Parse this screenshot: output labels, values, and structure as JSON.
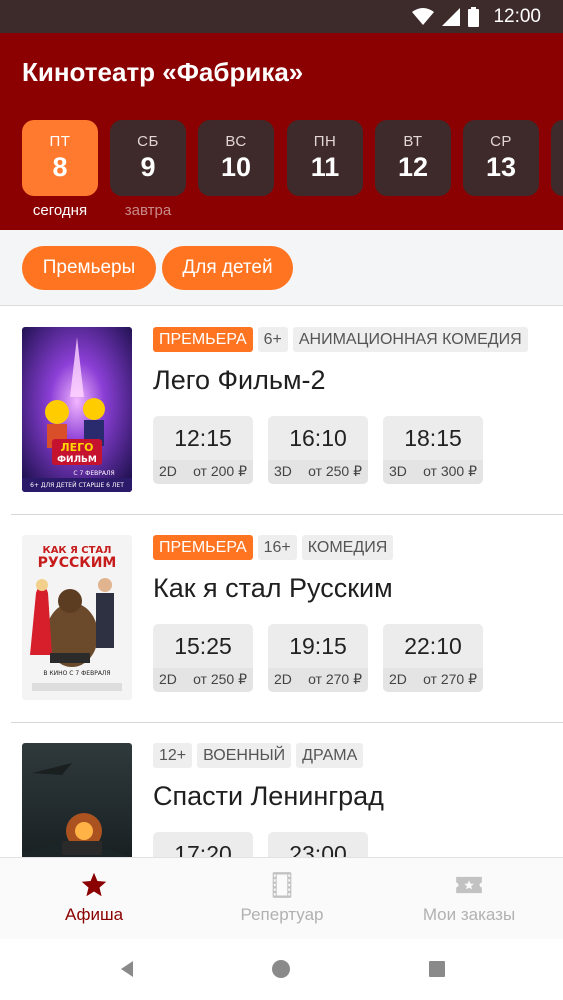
{
  "status": {
    "time": "12:00"
  },
  "app": {
    "title": "Кинотеатр «Фабрика»"
  },
  "days": [
    {
      "name": "ПТ",
      "num": "8",
      "sub": "сегодня",
      "active": true
    },
    {
      "name": "СБ",
      "num": "9",
      "sub": "завтра"
    },
    {
      "name": "ВС",
      "num": "10",
      "sub": ""
    },
    {
      "name": "ПН",
      "num": "11",
      "sub": ""
    },
    {
      "name": "ВТ",
      "num": "12",
      "sub": ""
    },
    {
      "name": "СР",
      "num": "13",
      "sub": ""
    }
  ],
  "filters": [
    "Премьеры",
    "Для детей"
  ],
  "movies": [
    {
      "tags": [
        "ПРЕМЬЕРА",
        "6+",
        "АНИМАЦИОННАЯ КОМЕДИЯ"
      ],
      "title": "Лего Фильм-2",
      "sessions": [
        {
          "time": "12:15",
          "format": "2D",
          "price": "от 200 ₽"
        },
        {
          "time": "16:10",
          "format": "3D",
          "price": "от 250 ₽"
        },
        {
          "time": "18:15",
          "format": "3D",
          "price": "от 300 ₽"
        }
      ]
    },
    {
      "tags": [
        "ПРЕМЬЕРА",
        "16+",
        "КОМЕДИЯ"
      ],
      "title": "Как я стал Русским",
      "sessions": [
        {
          "time": "15:25",
          "format": "2D",
          "price": "от 250 ₽"
        },
        {
          "time": "19:15",
          "format": "2D",
          "price": "от 270 ₽"
        },
        {
          "time": "22:10",
          "format": "2D",
          "price": "от 270 ₽"
        }
      ]
    },
    {
      "tags": [
        "12+",
        "ВОЕННЫЙ",
        "ДРАМА"
      ],
      "title": "Спасти Ленинград",
      "sessions": [
        {
          "time": "17:20",
          "format": "",
          "price": ""
        },
        {
          "time": "23:00",
          "format": "",
          "price": ""
        }
      ]
    }
  ],
  "posters": {
    "lego": {
      "caption": "6+ ДЛЯ ДЕТЕЙ СТАРШЕ 6 ЛЕТ",
      "logo_line1": "ЛЕГО",
      "logo_line2": "ФИЛЬМ",
      "date": "С 7 ФЕВРАЛЯ"
    },
    "russian": {
      "title_line1": "КАК Я СТАЛ",
      "title_line2": "РУССКИМ",
      "date": "В КИНО С 7 ФЕВРАЛЯ"
    }
  },
  "nav": [
    {
      "label": "Афиша",
      "icon": "star-icon",
      "active": true
    },
    {
      "label": "Репертуар",
      "icon": "film-icon"
    },
    {
      "label": "Мои заказы",
      "icon": "ticket-icon"
    }
  ],
  "colors": {
    "primary": "#8b0000",
    "accent": "#ff7420",
    "status_bar": "#3d2a2a",
    "day_box": "#3e2a2a"
  }
}
